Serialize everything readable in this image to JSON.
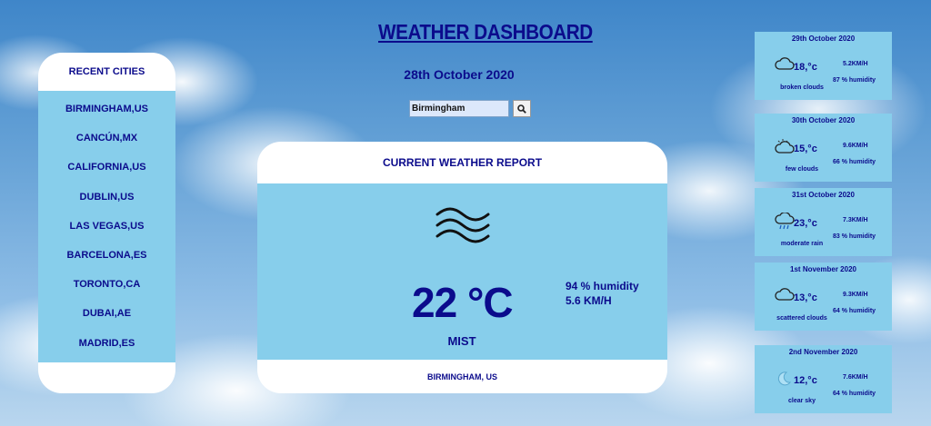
{
  "header": {
    "title": "WEATHER DASHBOARD",
    "date": "28th October 2020"
  },
  "search": {
    "value": "Birmingham",
    "button_icon": "search-icon"
  },
  "recent_cities": {
    "heading": "RECENT CITIES",
    "items": [
      {
        "label": "BIRMINGHAM,US"
      },
      {
        "label": "CANCÚN,MX"
      },
      {
        "label": "CALIFORNIA,US"
      },
      {
        "label": "DUBLIN,US"
      },
      {
        "label": "LAS VEGAS,US"
      },
      {
        "label": "BARCELONA,ES"
      },
      {
        "label": "TORONTO,CA"
      },
      {
        "label": "DUBAI,AE"
      },
      {
        "label": "MADRID,ES"
      }
    ]
  },
  "current": {
    "heading": "CURRENT WEATHER REPORT",
    "icon": "mist-icon",
    "temperature": "22 °C",
    "description": "MIST",
    "humidity": "94 % humidity",
    "wind": "5.6 KM/H",
    "location": "BIRMINGHAM, US"
  },
  "forecast": [
    {
      "date": "29th October 2020",
      "icon": "broken-clouds-icon",
      "temp": "18,°c",
      "description": "broken clouds",
      "wind": "5.2KM/H",
      "humidity": "87 % humidity"
    },
    {
      "date": "30th October 2020",
      "icon": "few-clouds-icon",
      "temp": "15,°c",
      "description": "few clouds",
      "wind": "9.6KM/H",
      "humidity": "66 % humidity"
    },
    {
      "date": "31st October 2020",
      "icon": "moderate-rain-icon",
      "temp": "23,°c",
      "description": "moderate rain",
      "wind": "7.3KM/H",
      "humidity": "83 % humidity"
    },
    {
      "date": "1st November 2020",
      "icon": "scattered-clouds-icon",
      "temp": "13,°c",
      "description": "scattered clouds",
      "wind": "9.3KM/H",
      "humidity": "64 % humidity"
    },
    {
      "date": "2nd November 2020",
      "icon": "clear-sky-icon",
      "temp": "12,°c",
      "description": "clear sky",
      "wind": "7.6KM/H",
      "humidity": "64 % humidity"
    }
  ],
  "colors": {
    "text": "#0b0b8c",
    "panel": "#87ceeb"
  }
}
